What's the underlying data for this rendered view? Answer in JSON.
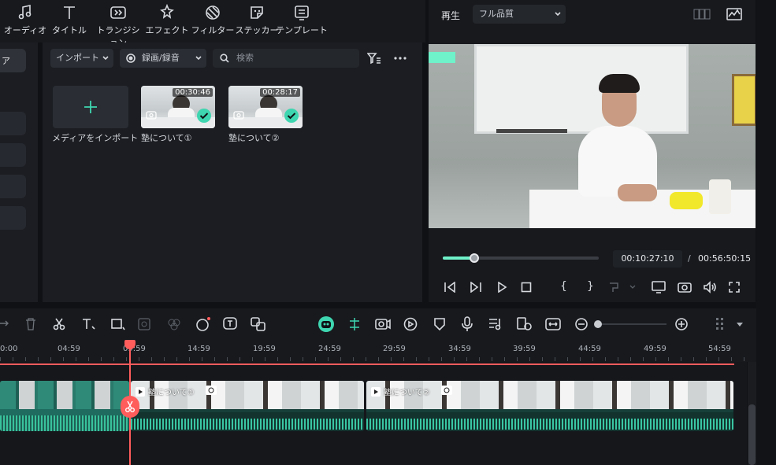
{
  "toolbar": {
    "items": [
      {
        "label": "オーディオ",
        "icon": "music-note-icon"
      },
      {
        "label": "タイトル",
        "icon": "text-t-icon"
      },
      {
        "label": "トランジション",
        "icon": "transition-icon"
      },
      {
        "label": "エフェクト",
        "icon": "effect-sparkle-icon"
      },
      {
        "label": "フィルター",
        "icon": "filter-icon"
      },
      {
        "label": "ステッカー",
        "icon": "sticker-icon"
      },
      {
        "label": "テンプレート",
        "icon": "template-icon"
      }
    ]
  },
  "leftnav": {
    "active_label": "ア"
  },
  "media": {
    "import_label": "インポート",
    "record_label": "録画/録音",
    "search_placeholder": "検索",
    "import_tile_label": "メディアをインポート",
    "clips": [
      {
        "name": "塾について①",
        "duration": "00:30:46"
      },
      {
        "name": "塾について②",
        "duration": "00:28:17"
      }
    ]
  },
  "preview": {
    "play_label": "再生",
    "quality_label": "フル品質",
    "current_time": "00:10:27:10",
    "separator": "/",
    "total_time": "00:56:50:15",
    "progress": 0.2
  },
  "timeline": {
    "ruler": [
      "0:00",
      "04:59",
      "09:59",
      "14:59",
      "19:59",
      "24:59",
      "29:59",
      "34:59",
      "39:59",
      "44:59",
      "49:59",
      "54:59"
    ],
    "clips": [
      {
        "name": "塾について①"
      },
      {
        "name": "塾について②"
      }
    ]
  },
  "colors": {
    "accent": "#3ed6b0",
    "playhead": "#ff5c5c",
    "bg": "#17191d"
  }
}
